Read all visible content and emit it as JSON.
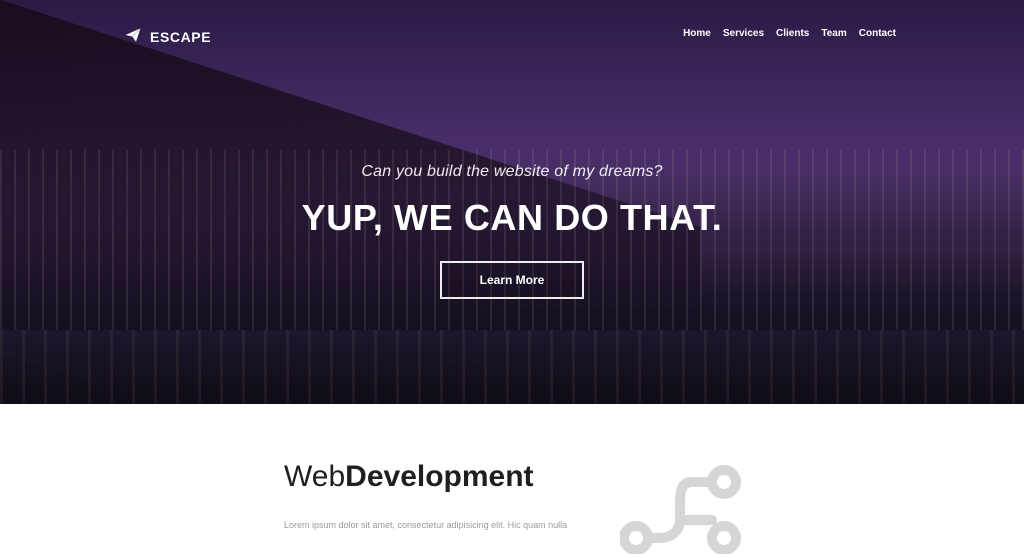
{
  "nav": {
    "brand": "ESCAPE",
    "items": [
      "Home",
      "Services",
      "Clients",
      "Team",
      "Contact"
    ]
  },
  "hero": {
    "kicker": "Can you build the website of my dreams?",
    "headline": "YUP, WE CAN DO THAT.",
    "cta": "Learn More"
  },
  "section": {
    "title_light": "Web",
    "title_bold": "Development",
    "body": "Lorem ipsum dolor sit amet, consectetur adipisicing elit. Hic quam nulla"
  },
  "icons": {
    "brand": "paper-plane-icon",
    "graphic": "connection-nodes-icon"
  },
  "colors": {
    "hero_purple": "#4a2f6b",
    "text_dark": "#1f1f1f",
    "text_muted": "#9a9a9a",
    "white": "#ffffff"
  }
}
